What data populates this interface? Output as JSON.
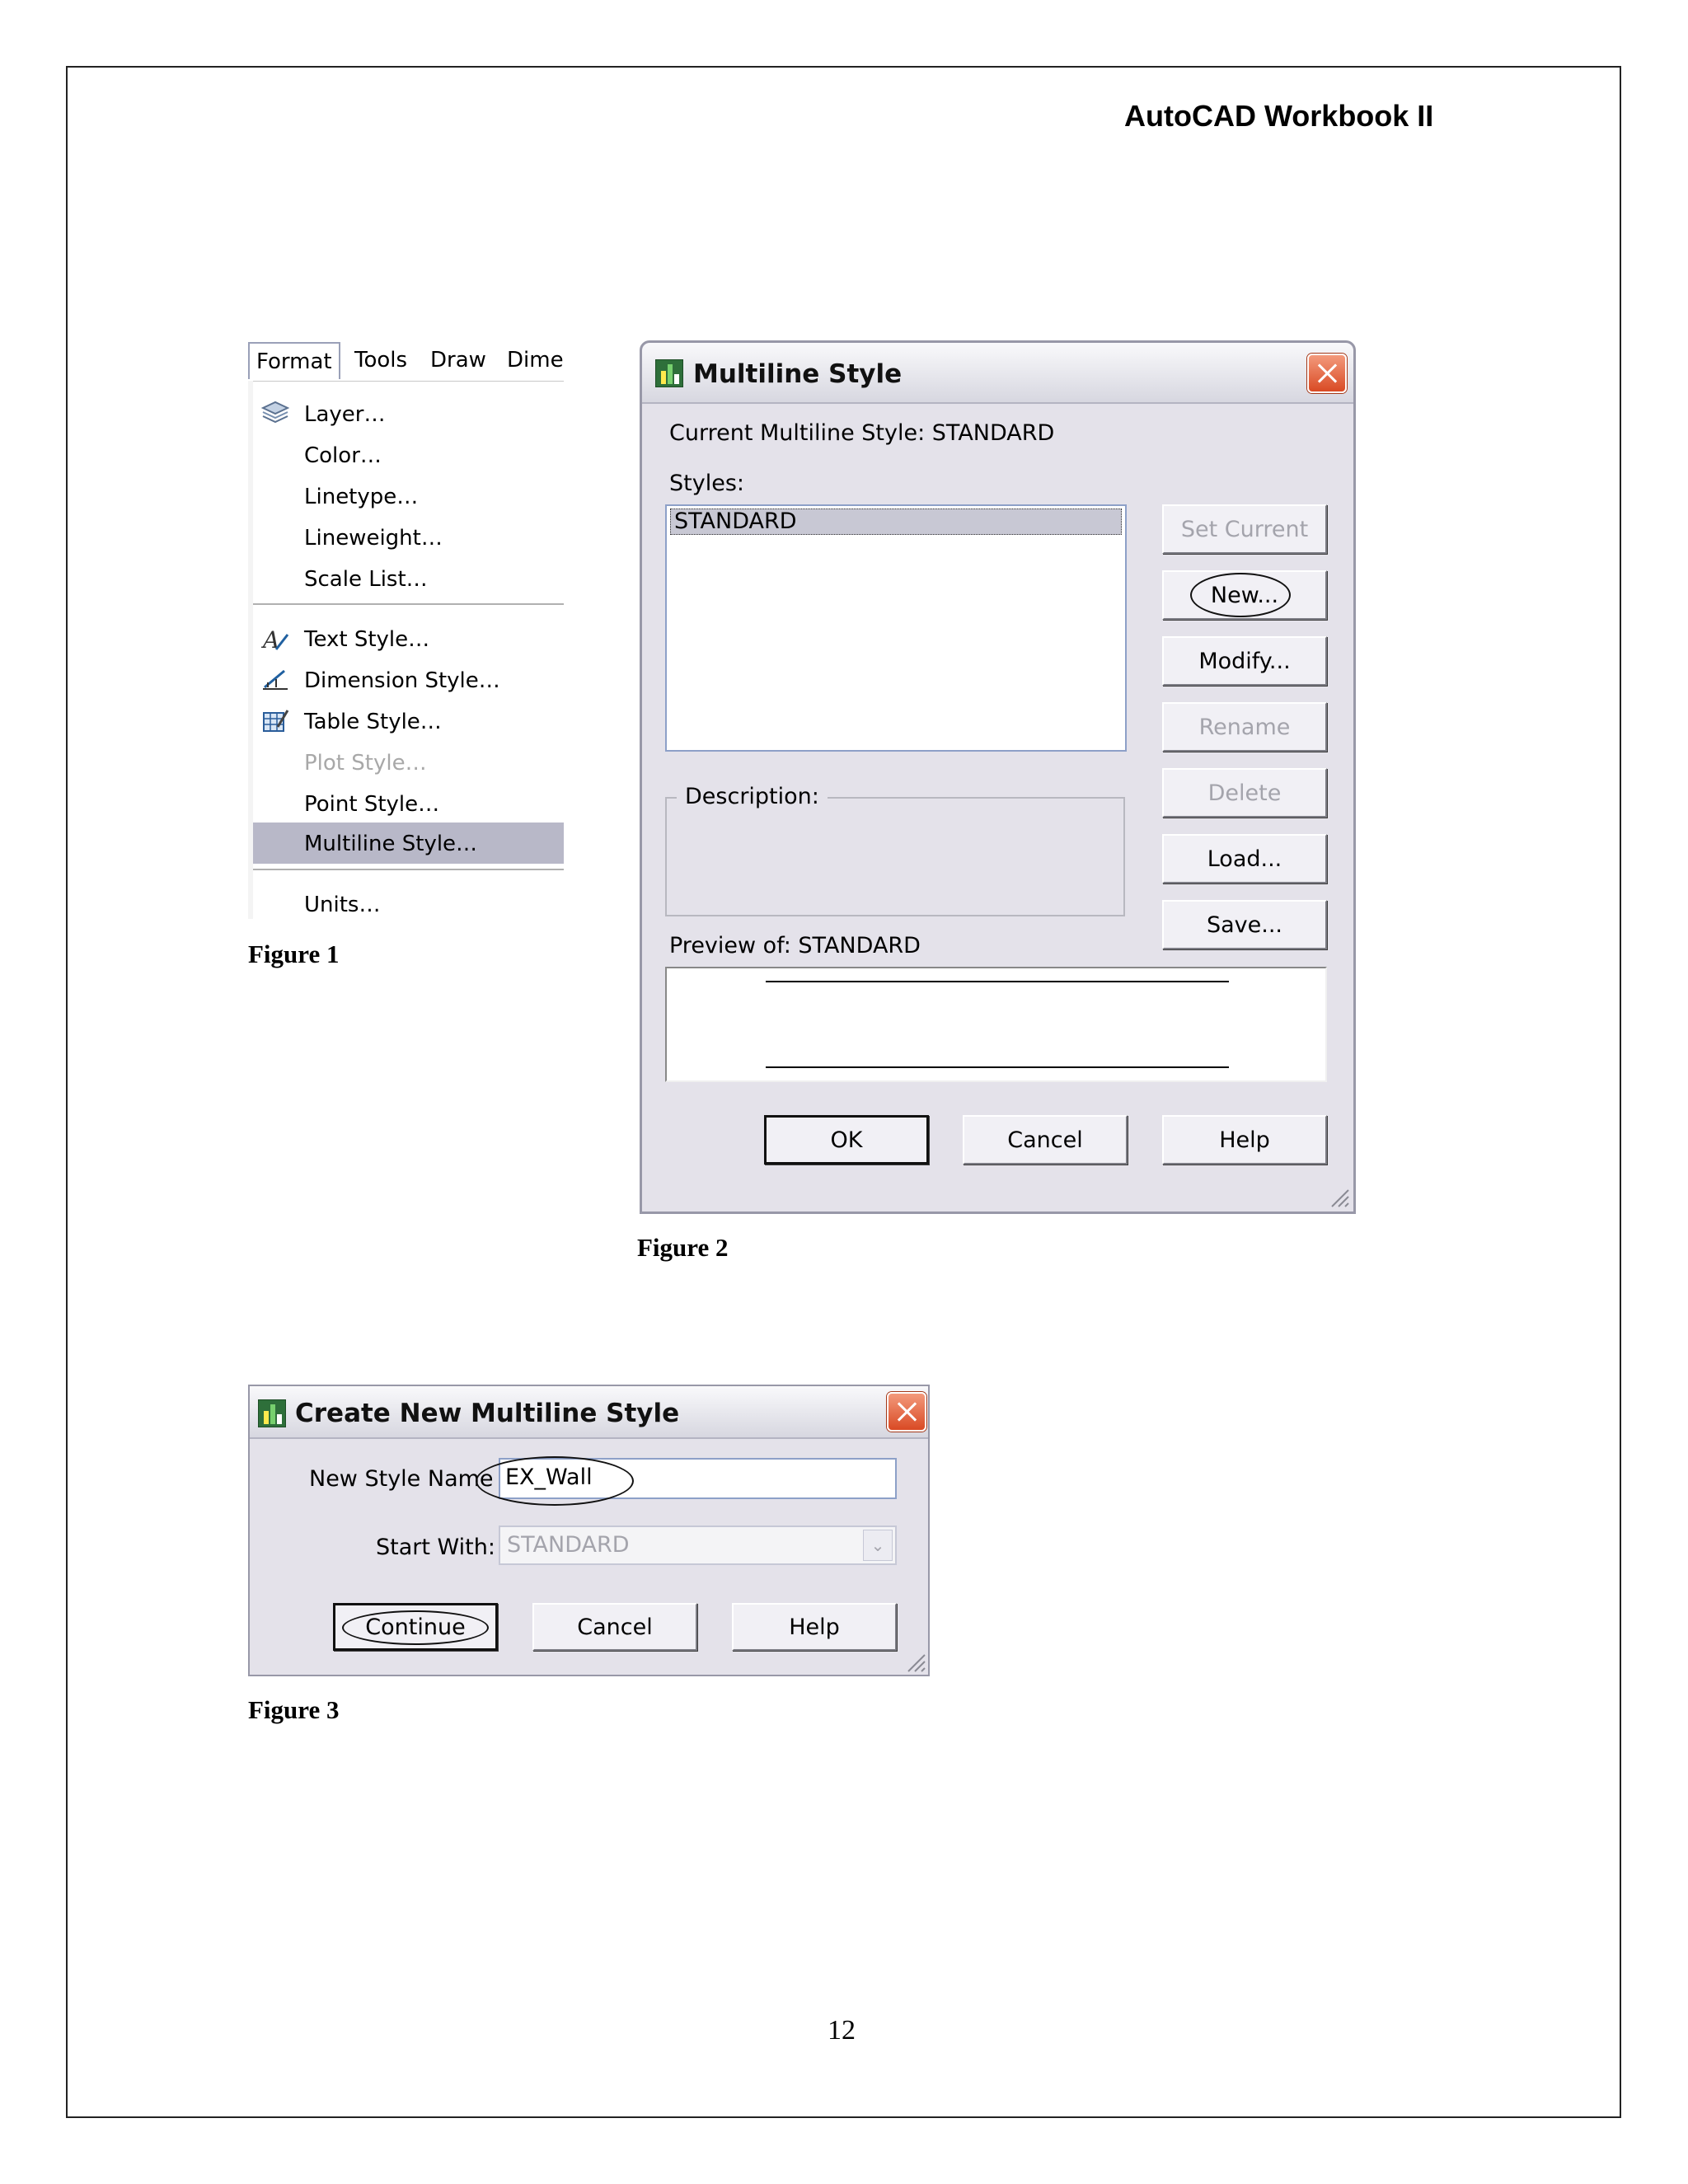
{
  "header": {
    "title": "AutoCAD Workbook II"
  },
  "figure1": {
    "caption": "Figure 1",
    "menubar": [
      "Format",
      "Tools",
      "Draw",
      "Dimer"
    ],
    "menu_items": [
      "Layer…",
      "Color…",
      "Linetype…",
      "Lineweight…",
      "Scale List…",
      "Text Style…",
      "Dimension Style…",
      "Table Style…",
      "Plot Style…",
      "Point Style…",
      "Multiline Style…",
      "Units…"
    ]
  },
  "figure2": {
    "caption": "Figure 2",
    "title": "Multiline Style",
    "current_style": "Current Multiline Style: STANDARD",
    "styles_label": "Styles:",
    "styles": [
      "STANDARD"
    ],
    "description_label": "Description:",
    "preview_label": "Preview of: STANDARD",
    "buttons": {
      "set_current": "Set Current",
      "new": "New...",
      "modify": "Modify...",
      "rename": "Rename",
      "delete": "Delete",
      "load": "Load...",
      "save": "Save...",
      "ok": "OK",
      "cancel": "Cancel",
      "help": "Help"
    }
  },
  "figure3": {
    "caption": "Figure 3",
    "title": "Create New Multiline Style",
    "name_label": "New Style Name",
    "name_value": "EX_Wall",
    "start_label": "Start With:",
    "start_value": "STANDARD",
    "buttons": {
      "continue": "Continue",
      "cancel": "Cancel",
      "help": "Help"
    }
  },
  "page_number": "12"
}
